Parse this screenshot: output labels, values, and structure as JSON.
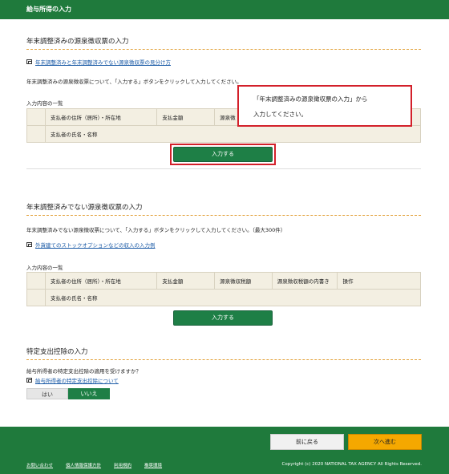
{
  "header": {
    "title": "給与所得の入力"
  },
  "section1": {
    "title": "年末調整済みの源泉徴収票の入力",
    "link": "年末調整済みと年末調整済みでない源泉徴収票の見分け方",
    "instruction": "年末調整済みの源泉徴収票について、「入力する」ボタンをクリックして入力してください。",
    "table_label": "入力内容の一覧",
    "columns": [
      "支払者の住所（居所）・所在地",
      "支払金額",
      "源泉徴",
      "",
      ""
    ],
    "columns_row2": [
      "支払者の氏名・名称"
    ],
    "button": "入力する"
  },
  "callout": {
    "line1": "「年末調整済みの源泉徴収票の入力」から",
    "line2": "入力してください。"
  },
  "section2": {
    "title": "年末調整済みでない源泉徴収票の入力",
    "instruction": "年末調整済みでない源泉徴収票について、「入力する」ボタンをクリックして入力してください。（最大300件）",
    "link": "外貨建てのストックオプションなどの収入の入力例",
    "table_label": "入力内容の一覧",
    "columns": [
      "支払者の住所（居所）・所在地",
      "支払金額",
      "源泉徴収税額",
      "源泉徴収税額の内書き",
      "操作"
    ],
    "columns_row2": [
      "支払者の氏名・名称"
    ],
    "button": "入力する"
  },
  "section3": {
    "title": "特定支出控除の入力",
    "question": "給与所得者の特定支出控除の適用を受けますか？",
    "link": "給与所得者の特定支出控除について",
    "yes": "はい",
    "no": "いいえ"
  },
  "footer": {
    "back": "前に戻る",
    "next": "次へ進む",
    "links": [
      "お問い合わせ",
      "個人情報保護方針",
      "利用規約",
      "推奨環境"
    ],
    "copyright": "Copyright (c) 2020 NATIONAL TAX AGENCY All Rights Reserved."
  }
}
